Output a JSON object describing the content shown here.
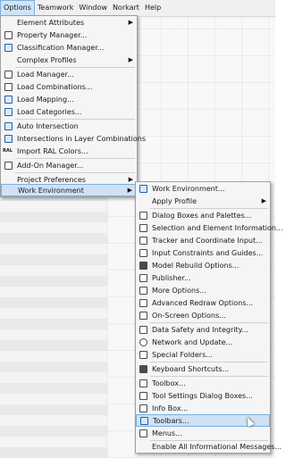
{
  "menubar": {
    "items": [
      {
        "label": "Options",
        "active": true
      },
      {
        "label": "Teamwork"
      },
      {
        "label": "Window"
      },
      {
        "label": "Norkart"
      },
      {
        "label": "Help"
      }
    ]
  },
  "options_menu": {
    "items": [
      {
        "label": "Element Attributes",
        "submenu": true
      },
      {
        "label": "Property Manager...",
        "icon": "property-manager-icon"
      },
      {
        "label": "Classification Manager...",
        "icon": "classification-manager-icon"
      },
      {
        "label": "Complex Profiles",
        "submenu": true
      },
      {
        "label": "Load Manager...",
        "icon": "load-manager-icon"
      },
      {
        "label": "Load Combinations...",
        "icon": "load-combinations-icon"
      },
      {
        "label": "Load Mapping...",
        "icon": "load-mapping-icon"
      },
      {
        "label": "Load Categories...",
        "icon": "load-categories-icon"
      },
      {
        "label": "Auto Intersection",
        "icon": "auto-intersection-icon"
      },
      {
        "label": "Intersections in Layer Combinations",
        "icon": "layer-intersections-icon"
      },
      {
        "label": "Import RAL Colors...",
        "icon": "ral-icon"
      },
      {
        "label": "Add-On Manager...",
        "icon": "addon-manager-icon"
      },
      {
        "label": "Project Preferences",
        "submenu": true
      },
      {
        "label": "Work Environment",
        "submenu": true,
        "highlighted": true
      }
    ]
  },
  "work_environment_menu": {
    "items": [
      {
        "label": "Work Environment...",
        "icon": "work-environment-icon"
      },
      {
        "label": "Apply Profile",
        "submenu": true
      },
      {
        "label": "Dialog Boxes and Palettes...",
        "icon": "dialog-boxes-icon"
      },
      {
        "label": "Selection and Element Information...",
        "icon": "selection-info-icon"
      },
      {
        "label": "Tracker and Coordinate Input...",
        "icon": "tracker-icon"
      },
      {
        "label": "Input Constraints and Guides...",
        "icon": "input-constraints-icon"
      },
      {
        "label": "Model Rebuild Options...",
        "icon": "model-rebuild-icon"
      },
      {
        "label": "Publisher...",
        "icon": "publisher-icon"
      },
      {
        "label": "More Options...",
        "icon": "more-options-icon"
      },
      {
        "label": "Advanced Redraw Options...",
        "icon": "advanced-redraw-icon"
      },
      {
        "label": "On-Screen Options...",
        "icon": "on-screen-options-icon"
      },
      {
        "label": "Data Safety and Integrity...",
        "icon": "data-safety-icon"
      },
      {
        "label": "Network and Update...",
        "icon": "network-icon"
      },
      {
        "label": "Special Folders...",
        "icon": "special-folders-icon"
      },
      {
        "label": "Keyboard Shortcuts...",
        "icon": "keyboard-shortcuts-icon"
      },
      {
        "label": "Toolbox...",
        "icon": "toolbox-icon"
      },
      {
        "label": "Tool Settings Dialog Boxes...",
        "icon": "tool-settings-icon"
      },
      {
        "label": "Info Box...",
        "icon": "info-box-icon"
      },
      {
        "label": "Toolbars...",
        "icon": "toolbars-icon",
        "highlighted": true
      },
      {
        "label": "Menus...",
        "icon": "menus-icon"
      },
      {
        "label": "Enable All Informational Messages..."
      }
    ]
  },
  "colors": {
    "highlight": "#cfe1f6",
    "highlight_border": "#7ab0dd",
    "menu_bg": "#f5f5f5"
  }
}
